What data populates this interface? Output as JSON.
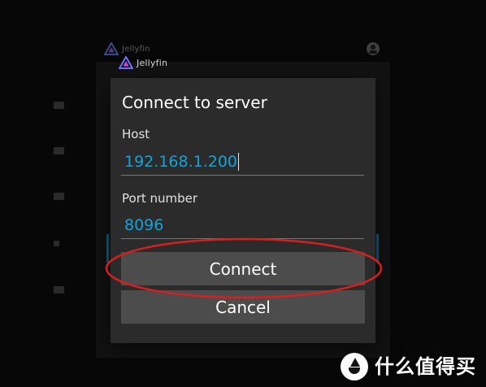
{
  "background": {
    "brand_name": "Jellyfin"
  },
  "brand": {
    "name": "Jellyfin"
  },
  "dialog": {
    "title": "Connect to server",
    "host": {
      "label": "Host",
      "value": "192.168.1.200"
    },
    "port": {
      "label": "Port number",
      "value": "8096"
    },
    "buttons": {
      "connect": "Connect",
      "cancel": "Cancel"
    }
  },
  "watermark": {
    "text": "什么值得买"
  },
  "colors": {
    "background": "#070707",
    "dialog_bg": "#2b2b2b",
    "button_bg": "#4c4c4c",
    "input_text": "#15a3d9",
    "highlight": "#d61f1f"
  },
  "icons": {
    "logo": "jellyfin-logo-icon",
    "user": "user-account-icon",
    "watermark": "smzdm-logo-icon"
  }
}
